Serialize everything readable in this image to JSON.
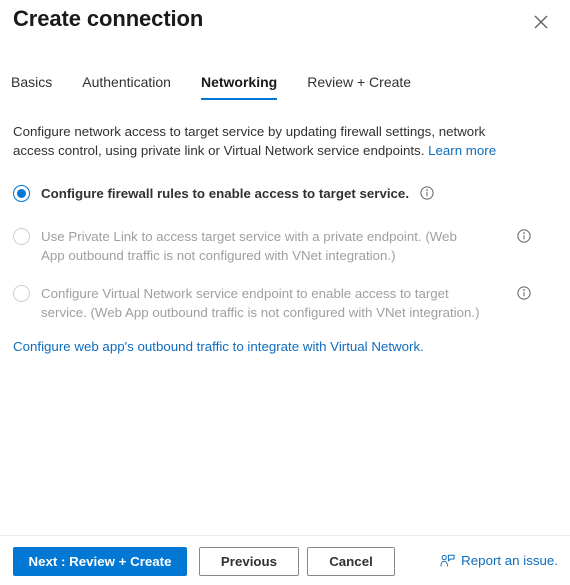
{
  "window": {
    "title": "Create connection",
    "close_icon": "close-icon"
  },
  "tabs": [
    {
      "label": "Basics",
      "selected": false
    },
    {
      "label": "Authentication",
      "selected": false
    },
    {
      "label": "Networking",
      "selected": true
    },
    {
      "label": "Review + Create",
      "selected": false
    }
  ],
  "description": {
    "text": "Configure network access to target service by updating firewall settings, network access control, using private link or Virtual Network service endpoints.",
    "learn_more": "Learn more"
  },
  "options": [
    {
      "label": "Configure firewall rules to enable access to target service.",
      "checked": true,
      "disabled": false,
      "info_icon": "info-icon"
    },
    {
      "label": "Use Private Link to access target service with a private endpoint. (Web App outbound traffic is not configured with VNet integration.)",
      "checked": false,
      "disabled": true,
      "info_icon": "info-icon"
    },
    {
      "label": "Configure Virtual Network service endpoint to enable access to target service. (Web App outbound traffic is not configured with VNet integration.)",
      "checked": false,
      "disabled": true,
      "info_icon": "info-icon"
    }
  ],
  "vnet_link": "Configure web app's outbound traffic to integrate with Virtual Network.",
  "footer": {
    "next_label": "Next : Review + Create",
    "previous_label": "Previous",
    "cancel_label": "Cancel",
    "report_issue_label": "Report an issue.",
    "report_issue_icon": "feedback-person-icon"
  },
  "colors": {
    "accent": "#0078d4",
    "link": "#0f6cbd",
    "disabled_text": "#a19f9d"
  }
}
